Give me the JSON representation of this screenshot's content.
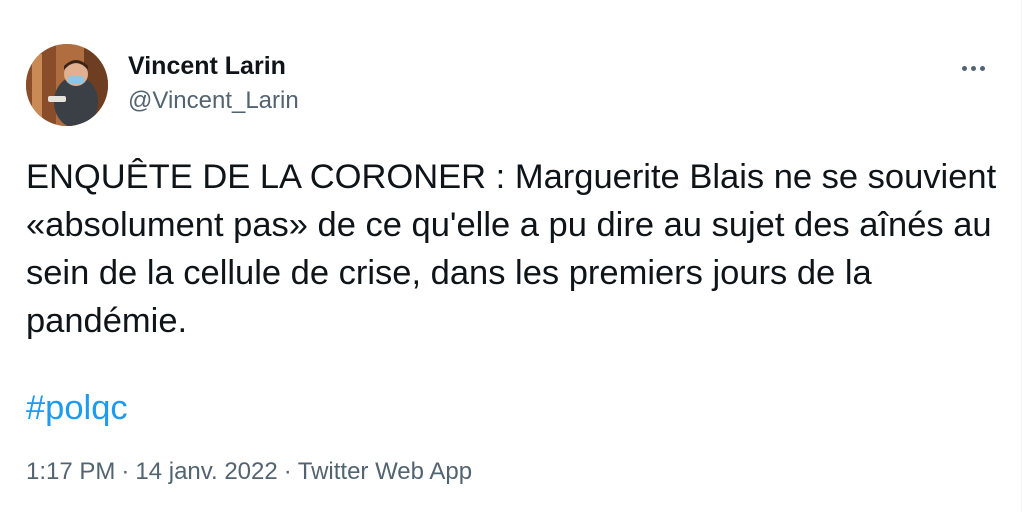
{
  "author": {
    "display_name": "Vincent Larin",
    "handle": "@Vincent_Larin",
    "avatar_icon": "profile-photo"
  },
  "more_icon": "more-horizontal-icon",
  "tweet": {
    "text": "ENQUÊTE DE LA CORONER : Marguerite Blais ne se souvient «absolument pas» de ce qu'elle a pu dire au sujet des aînés au sein de la cellule de crise, dans les premiers jours de la pandémie.",
    "hashtag": "#polqc"
  },
  "meta": {
    "time": "1:17 PM",
    "separator": "·",
    "date": "14 janv. 2022",
    "source": "Twitter Web App"
  },
  "colors": {
    "text": "#0f1419",
    "secondary": "#536471",
    "link": "#1d9bf0",
    "background": "#ffffff"
  }
}
